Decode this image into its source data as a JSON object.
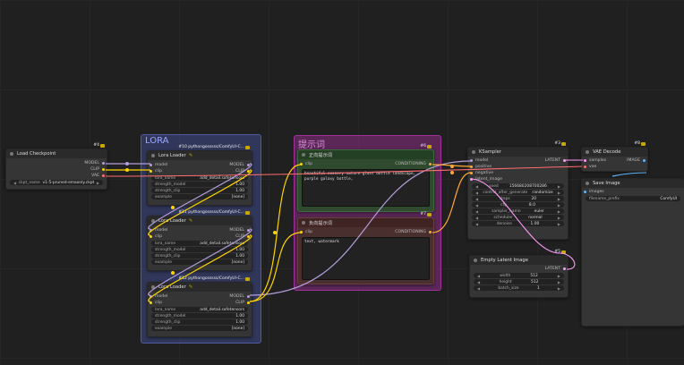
{
  "groups": {
    "lora": {
      "title": "LORA",
      "color": "#3f4a8a"
    },
    "prompt": {
      "title": "提示词",
      "color": "#a1309b"
    }
  },
  "nodes": {
    "load_checkpoint": {
      "id": "#4",
      "title": "Load Checkpoint",
      "outputs": [
        "MODEL",
        "CLIP",
        "VAE"
      ],
      "widgets": [
        {
          "name": "ckpt_name",
          "value": "v1-5-pruned-emaonly.ckpt"
        }
      ]
    },
    "lora1": {
      "id": "#10 pythongosssss/ComfyUI-C...",
      "title": "Lora Loader",
      "inputs": [
        "model",
        "clip"
      ],
      "outputs": [
        "MODEL",
        "CLIP"
      ],
      "widgets": [
        {
          "name": "lora_name",
          "value": "add_detail.safetensors"
        },
        {
          "name": "strength_model",
          "value": "1.00"
        },
        {
          "name": "strength_clip",
          "value": "1.00"
        },
        {
          "name": "example",
          "value": "[none]"
        }
      ]
    },
    "lora2": {
      "id": "#11 pythongosssss/ComfyUI-C...",
      "title": "Lora Loader",
      "inputs": [
        "model",
        "clip"
      ],
      "outputs": [
        "MODEL",
        "CLIP"
      ],
      "widgets": [
        {
          "name": "lora_name",
          "value": "add_detail.safetensors"
        },
        {
          "name": "strength_model",
          "value": "1.00"
        },
        {
          "name": "strength_clip",
          "value": "1.00"
        },
        {
          "name": "example",
          "value": "[none]"
        }
      ]
    },
    "lora3": {
      "id": "#12 pythongosssss/ComfyUI-C...",
      "title": "Lora Loader",
      "inputs": [
        "model",
        "clip"
      ],
      "outputs": [
        "MODEL",
        "CLIP"
      ],
      "widgets": [
        {
          "name": "lora_name",
          "value": "add_detail.safetensors"
        },
        {
          "name": "strength_model",
          "value": "1.00"
        },
        {
          "name": "strength_clip",
          "value": "1.00"
        },
        {
          "name": "example",
          "value": "[none]"
        }
      ]
    },
    "positive": {
      "id": "#6",
      "title": "正向提示词",
      "inputs": [
        "clip"
      ],
      "outputs": [
        "CONDITIONING"
      ],
      "text": "beautiful scenery nature glass bottle landscape, , purple galaxy bottle,"
    },
    "negative": {
      "id": "#7",
      "title": "负向提示词",
      "inputs": [
        "clip"
      ],
      "outputs": [
        "CONDITIONING"
      ],
      "text": "text, watermark"
    },
    "ksampler": {
      "id": "#3",
      "title": "KSampler",
      "inputs": [
        "model",
        "positive",
        "negative",
        "latent_image"
      ],
      "outputs": [
        "LATENT"
      ],
      "widgets": [
        {
          "name": "seed",
          "value": "156680208700286"
        },
        {
          "name": "control_after_generate",
          "value": "randomize"
        },
        {
          "name": "steps",
          "value": "20"
        },
        {
          "name": "cfg",
          "value": "8.0"
        },
        {
          "name": "sampler_name",
          "value": "euler"
        },
        {
          "name": "scheduler",
          "value": "normal"
        },
        {
          "name": "denoise",
          "value": "1.00"
        }
      ]
    },
    "empty_latent": {
      "id": "#5",
      "title": "Empty Latent Image",
      "outputs": [
        "LATENT"
      ],
      "widgets": [
        {
          "name": "width",
          "value": "512"
        },
        {
          "name": "height",
          "value": "512"
        },
        {
          "name": "batch_size",
          "value": "1"
        }
      ]
    },
    "vae_decode": {
      "id": "#8",
      "title": "VAE Decode",
      "inputs": [
        "samples",
        "vae"
      ],
      "outputs": [
        "IMAGE"
      ]
    },
    "save_image": {
      "id": "#9",
      "title": "Save Image",
      "inputs": [
        "images"
      ],
      "widgets": [
        {
          "name": "filename_prefix",
          "value": "ComfyUI"
        }
      ],
      "prefix_display": "filename_prefix"
    }
  },
  "colors": {
    "model": "#b39ddb",
    "clip": "#ffd500",
    "vae": "#ff6e6e",
    "conditioning": "#ffa931",
    "latent": "#ff9cf9",
    "image": "#64b5f6"
  }
}
